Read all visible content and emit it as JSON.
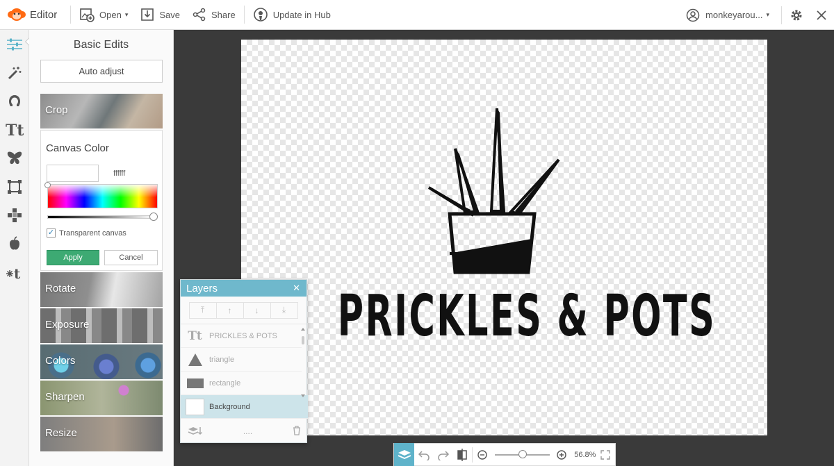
{
  "app": {
    "name": "Editor",
    "brand_color": "#ff6a13"
  },
  "toolbar": {
    "open_label": "Open",
    "save_label": "Save",
    "share_label": "Share",
    "hub_label": "Update in Hub",
    "user_name": "monkeyarou..."
  },
  "sidebar_icons": [
    "sliders-icon",
    "magic-wand-icon",
    "face-icon",
    "text-icon",
    "butterfly-icon",
    "frame-icon",
    "texture-icon",
    "apple-icon",
    "snowflake-t-icon"
  ],
  "panel": {
    "title": "Basic Edits",
    "auto_adjust_label": "Auto adjust",
    "crop_label": "Crop",
    "canvas_color": {
      "title": "Canvas Color",
      "hex_value": "ffffff",
      "transparent_label": "Transparent canvas",
      "transparent_checked": true,
      "apply_label": "Apply",
      "cancel_label": "Cancel",
      "apply_color": "#3daa73"
    },
    "rotate_label": "Rotate",
    "exposure_label": "Exposure",
    "colors_label": "Colors",
    "sharpen_label": "Sharpen",
    "resize_label": "Resize"
  },
  "canvas": {
    "logo_text": "PRICKLES & POTS"
  },
  "layers": {
    "title": "Layers",
    "header_color": "#6fb8cc",
    "items": [
      {
        "label": "PRICKLES & POTS",
        "type": "text"
      },
      {
        "label": "triangle",
        "type": "triangle"
      },
      {
        "label": "rectangle",
        "type": "rectangle"
      },
      {
        "label": "Background",
        "type": "background"
      }
    ],
    "selected": "Background"
  },
  "zoom": {
    "value": "56.8%",
    "level": 0.47
  }
}
